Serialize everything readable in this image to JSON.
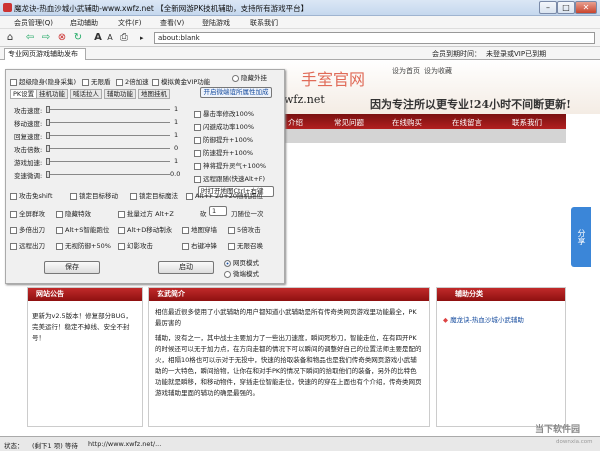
{
  "window": {
    "title": "魔龙诀-热血沙城小武辅助-www.xwfz.net  【全新网游PK技机辅助，支持所有游戏平台】"
  },
  "menu": [
    "会员管理(Q)",
    "启动辅助",
    "文件(F)",
    "查看(V)",
    "登陆游戏",
    "联系我们"
  ],
  "address": "about:blank",
  "tab": "专业网页游戏辅助发布",
  "member": {
    "label": "会员到期时间：",
    "value": "未登录或VIP已到期"
  },
  "site": {
    "top_links": [
      "设为首页",
      "设为收藏"
    ],
    "logo": "手室官网",
    "domain": "wfz.net",
    "slogan": "因为专注所以更专业!24小时不间断更新!",
    "nav": [
      "介绍",
      "常见问题",
      "在线购买",
      "在线留言",
      "联系我们"
    ]
  },
  "panel": {
    "top_checks": [
      "超级隐身(隐身采集)",
      "无限盾",
      "2倍加速",
      "模拟黄金VIP功能"
    ],
    "hide_label": "隐藏外挂",
    "tabs": [
      "PK设置",
      "挂机功能",
      "喊话拉人",
      "辅助功能",
      "地图挂机"
    ],
    "link": "开启微端谊所属性加成",
    "sliders": [
      {
        "label": "攻击速度:",
        "value": "1"
      },
      {
        "label": "移动速度:",
        "value": "1"
      },
      {
        "label": "回复速度:",
        "value": "1"
      },
      {
        "label": "攻击倍数:",
        "value": "0"
      },
      {
        "label": "游戏加速:",
        "value": "1"
      },
      {
        "label": "变速微调:",
        "value": "0.0"
      }
    ],
    "slider_fill": [
      0.0,
      0.0,
      0.0,
      0.0,
      0.0,
      0.0
    ],
    "right_checks": [
      "暴击率修改100%",
      "闪避成功率100%",
      "防御提升+100%",
      "防速提升+100%",
      "神将提升灵气+100%",
      "远程跟随(快速Alt+F)"
    ],
    "map_label": "时打开地图Ctrl+右键",
    "grid1": [
      "攻击免shift",
      "锁定目标移动",
      "锁定目标魔法",
      "Alt+F 20+20随机跑位"
    ],
    "grid2": [
      "全屏群攻",
      "隐藏特效",
      "批量过方 Alt+Z",
      "砍",
      "刀随位一次"
    ],
    "kan_value": "1",
    "grid3": [
      "多倍出刀",
      "Alt+S智能跑位",
      "Alt+D移动制永",
      "地图穿墙",
      "5倍攻击"
    ],
    "grid4": [
      "远程出刀",
      "无视防御+50%",
      "幻影攻击",
      "右键冲锋",
      "无限召唤"
    ],
    "save_btn": "保存",
    "start_btn": "启动",
    "modes": [
      "网页模式",
      "微端模式"
    ]
  },
  "boxes": {
    "notice": {
      "title": "网站公告",
      "text": "更新为v2.5版本！修复部分BUG，完美运行！稳定不掉线、安全不封号！"
    },
    "intro": {
      "title": "玄武简介",
      "lines": [
        "相信最近很多使用了小武辅助的用户都知道小武辅助是所有传奇类网页游戏里功能最全，PK最厉害的",
        "辅助，没有之一，其中战士主要加力了一些出刀速度，瞬间死秒刀，智能走位，在有四开PK的时候还可以无于加力点，在方向走都的情况下可以瞬间的调整好自己的位置法师主要是配的火，相隔10格也可以示对于无投中，快速的拾取装备和物品也是我们传奇类网页游戏小武辅助的一大特色，瞬间拾物，让你在和对手PK的情况下瞬间的拾取他们的装备，另外的比特色功能就是瞬移，和移动物件，穿插走位智能走位，快速的的穿在上面也有个介绍，传奇类网页游戏辅助里面的辅功的确是最强的。"
      ]
    },
    "cat": {
      "title": "辅助分类",
      "items": [
        "魔龙诀-热血沙城小武辅助"
      ]
    }
  },
  "status": {
    "label": "状态：",
    "count": "(剩下1 项) 等待",
    "url": "http://www.xwfz.net/..."
  },
  "watermark": {
    "main": "当下软件园",
    "sub": "downxia.com"
  }
}
